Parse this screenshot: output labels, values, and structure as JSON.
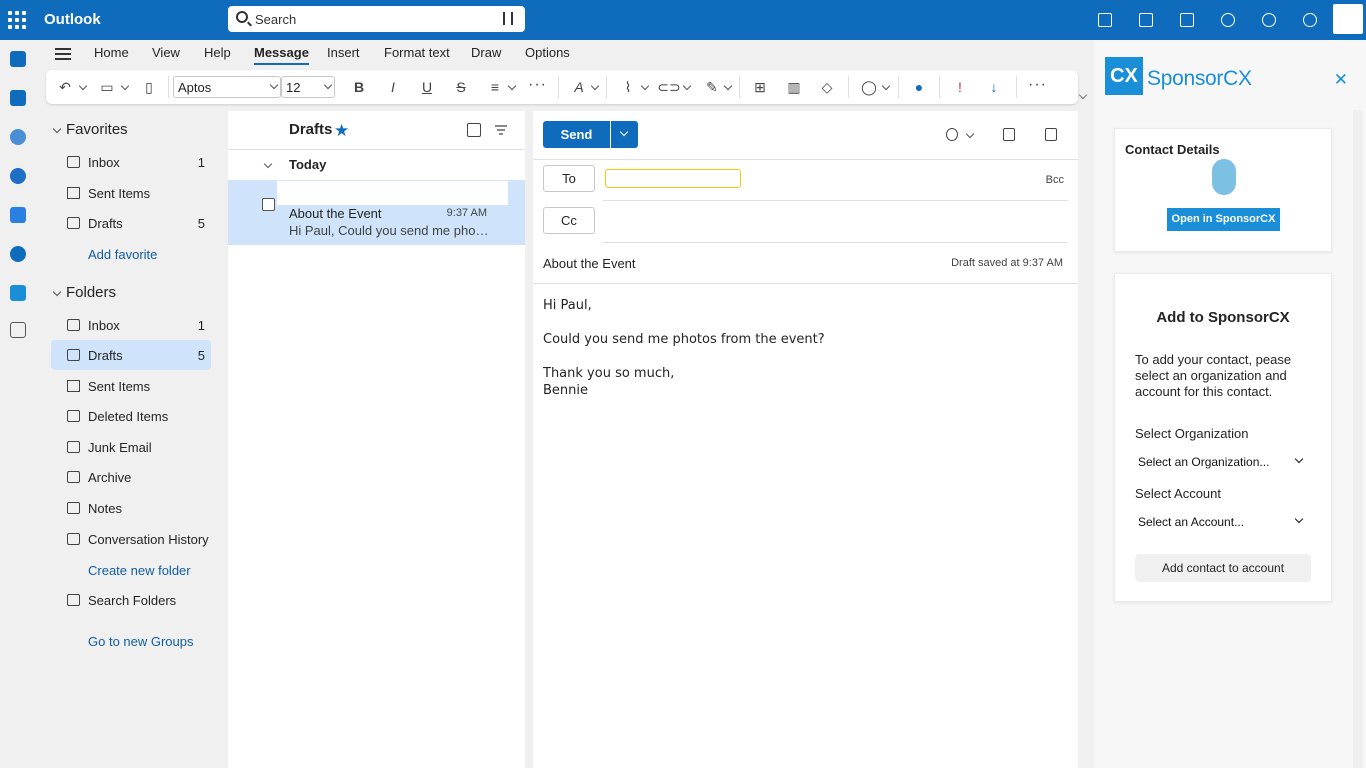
{
  "app": {
    "title": "Outlook"
  },
  "search": {
    "placeholder": "Search"
  },
  "topbar_icons": [
    "my-day-icon",
    "teams-icon",
    "notes-icon",
    "bell-icon",
    "settings-icon",
    "lightbulb-icon"
  ],
  "ribbon": {
    "tabs": [
      "Home",
      "View",
      "Help",
      "Message",
      "Insert",
      "Format text",
      "Draw",
      "Options"
    ],
    "active_tab": "Message",
    "font_name": "Aptos",
    "font_size": "12"
  },
  "favorites": {
    "header": "Favorites",
    "items": [
      {
        "label": "Inbox",
        "count": "1"
      },
      {
        "label": "Sent Items",
        "count": ""
      },
      {
        "label": "Drafts",
        "count": "5"
      }
    ],
    "add_link": "Add favorite"
  },
  "folders": {
    "header": "Folders",
    "items": [
      {
        "label": "Inbox",
        "count": "1"
      },
      {
        "label": "Drafts",
        "count": "5"
      },
      {
        "label": "Sent Items",
        "count": ""
      },
      {
        "label": "Deleted Items",
        "count": ""
      },
      {
        "label": "Junk Email",
        "count": ""
      },
      {
        "label": "Archive",
        "count": ""
      },
      {
        "label": "Notes",
        "count": ""
      },
      {
        "label": "Conversation History",
        "count": ""
      }
    ],
    "create_link": "Create new folder",
    "search_folders": "Search Folders",
    "groups_link": "Go to new Groups"
  },
  "message_list": {
    "title": "Drafts",
    "group": "Today",
    "items": [
      {
        "subject": "About the Event",
        "time": "9:37 AM",
        "preview": "Hi Paul, Could you send me photos from the event?"
      }
    ]
  },
  "compose": {
    "send_label": "Send",
    "to_label": "To",
    "cc_label": "Cc",
    "bcc_label": "Bcc",
    "to_value": "",
    "subject": "About the Event",
    "draft_status": "Draft saved at 9:37 AM",
    "body": [
      "Hi Paul,",
      "Could you send me photos from the event?",
      "Thank you so much,",
      "Bennie"
    ]
  },
  "addin": {
    "logo_text": "CX",
    "name": "SponsorCX",
    "contact_details": "Contact Details",
    "open_button": "Open in SponsorCX",
    "add_title": "Add to SponsorCX",
    "add_desc": "To add your contact, pease select an organization and account for this contact.",
    "org_label": "Select Organization",
    "org_value": "Select an Organization...",
    "account_label": "Select Account",
    "account_value": "Select an Account...",
    "add_button": "Add contact to account"
  },
  "colors": {
    "brand": "#0f6cbd",
    "selection": "#cfe4fa",
    "addin_accent": "#1a8fd8"
  }
}
